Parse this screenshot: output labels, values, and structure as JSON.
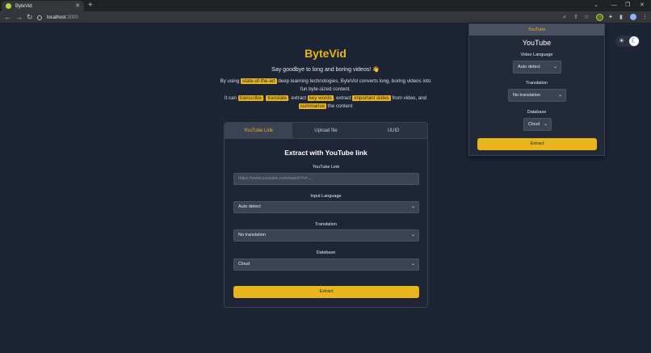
{
  "browser": {
    "tab_title": "ByteVid",
    "tab_close": "✕",
    "new_tab": "+",
    "url_host": "localhost",
    "url_port": ":3000",
    "icons": [
      "back-icon",
      "forward-icon",
      "reload-icon",
      "info-icon",
      "zoom-icon",
      "share-icon",
      "star-icon",
      "extension-icon",
      "puzzle-icon",
      "sidepanel-icon",
      "profile-icon",
      "menu-icon"
    ]
  },
  "page": {
    "brand": "ByteVid",
    "tagline": "Say goodbye to long and boring videos! 👋",
    "desc1": {
      "before": "By using ",
      "highlight": "state-of-the-art",
      "after": " deep learning technologies, ByteVid converts long, boring videos into fun byte-sized content."
    },
    "desc2": {
      "p1": "It can ",
      "h1": "transcribe",
      "s1": ", ",
      "h2": "translate",
      "s2": ", extract ",
      "h3": "key words",
      "s3": ", extract ",
      "h4": "important slides",
      "s4": " from video, and ",
      "h5": "summarise",
      "s5": " the content"
    }
  },
  "card": {
    "tabs": [
      "YouTube Link",
      "Upload file",
      "UUID"
    ],
    "active_tab": 0,
    "title": "Extract with YouTube link",
    "youtube_label": "YouTube Link",
    "youtube_placeholder": "https://www.youtube.com/watch?v=....",
    "input_language_label": "Input Language",
    "input_language_value": "Auto detect",
    "translation_label": "Translation",
    "translation_value": "No translation",
    "database_label": "Database",
    "database_value": "Cloud",
    "extract_label": "Extract"
  },
  "popup": {
    "header": "YouTube",
    "title": "YouTube",
    "video_language_label": "Video Language",
    "video_language_value": "Auto detect",
    "translation_label": "Translation",
    "translation_value": "No translation",
    "database_label": "Database",
    "database_value": "Cloud",
    "extract_label": "Extract"
  },
  "colors": {
    "accent": "#e9b51c",
    "background": "#1d2434",
    "panel": "#222938"
  }
}
